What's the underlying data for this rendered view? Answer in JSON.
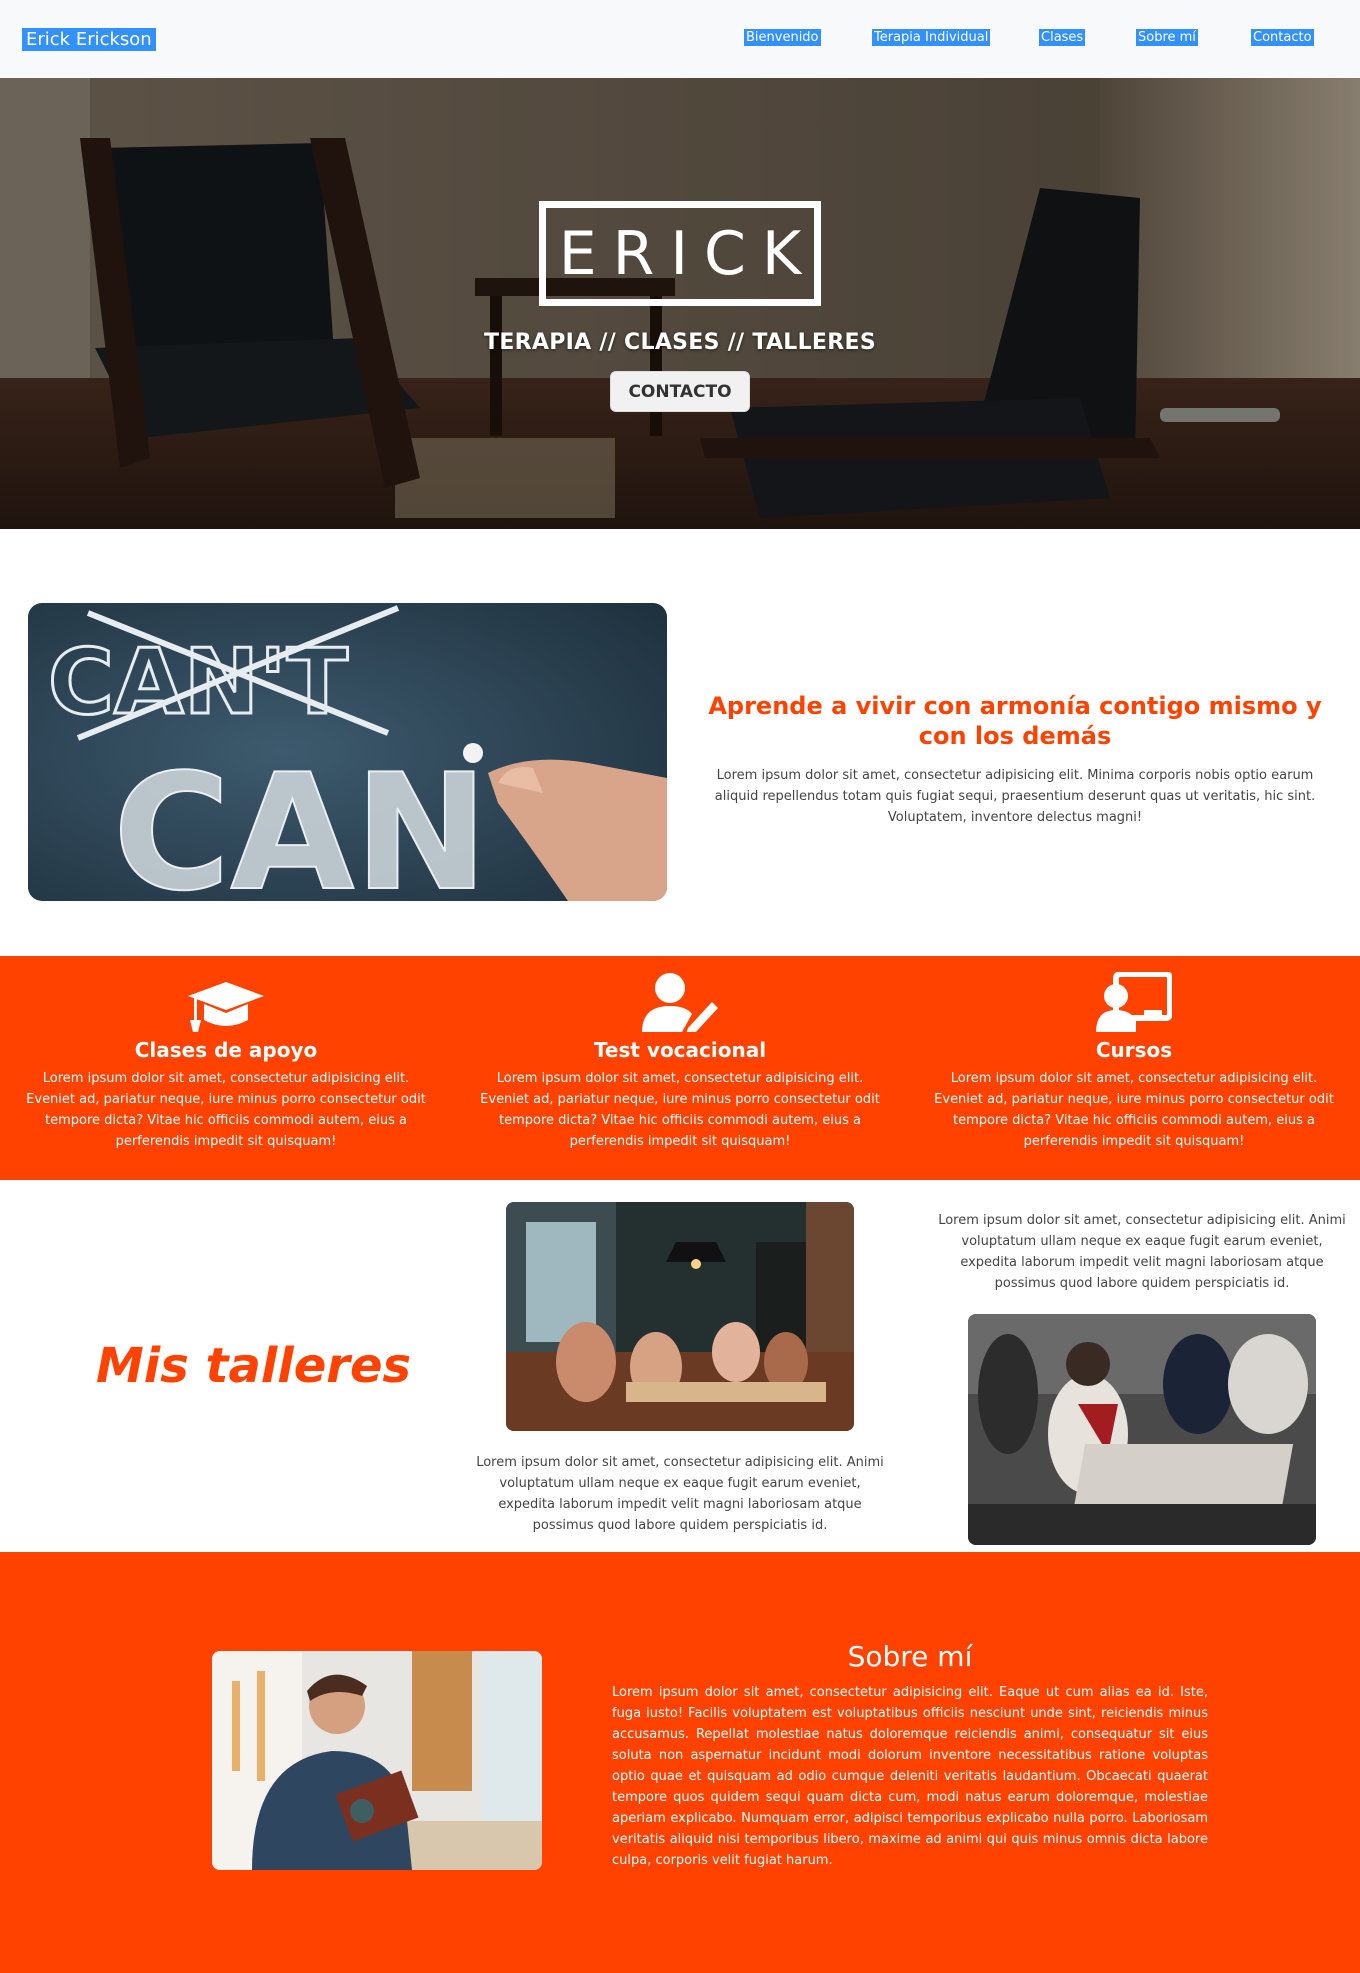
{
  "nav": {
    "brand": "Erick Erickson",
    "links": [
      "Bienvenido",
      "Terapia Individual",
      "Clases",
      "Sobre mí",
      "Contacto"
    ]
  },
  "hero": {
    "logo": "ERICK",
    "tagline": "TERAPIA // CLASES // TALLERES",
    "button": "CONTACTO"
  },
  "harmony": {
    "image_words": [
      "CAN'T",
      "CAN"
    ],
    "title": "Aprende a vivir con armonía contigo mismo y con los demás",
    "body": "Lorem ipsum dolor sit amet, consectetur adipisicing elit. Minima corporis nobis optio earum aliquid repellendus totam quis fugiat sequi, praesentium deserunt quas ut veritatis, hic sint. Voluptatem, inventore delectus magni!"
  },
  "services": [
    {
      "icon": "graduation-cap-icon",
      "title": "Clases de apoyo",
      "body": "Lorem ipsum dolor sit amet, consectetur adipisicing elit. Eveniet ad, pariatur neque, iure minus porro consectetur odit tempore dicta? Vitae hic officiis commodi autem, eius a perferendis impedit sit quisquam!"
    },
    {
      "icon": "user-pen-icon",
      "title": "Test vocacional",
      "body": "Lorem ipsum dolor sit amet, consectetur adipisicing elit. Eveniet ad, pariatur neque, iure minus porro consectetur odit tempore dicta? Vitae hic officiis commodi autem, eius a perferendis impedit sit quisquam!"
    },
    {
      "icon": "chalkboard-teacher-icon",
      "title": "Cursos",
      "body": "Lorem ipsum dolor sit amet, consectetur adipisicing elit. Eveniet ad, pariatur neque, iure minus porro consectetur odit tempore dicta? Vitae hic officiis commodi autem, eius a perferendis impedit sit quisquam!"
    }
  ],
  "workshops": {
    "title": "Mis talleres",
    "text1": "Lorem ipsum dolor sit amet, consectetur adipisicing elit. Animi voluptatum ullam neque ex eaque fugit earum eveniet, expedita laborum impedit velit magni laboriosam atque possimus quod labore quidem perspiciatis id.",
    "text2": "Lorem ipsum dolor sit amet, consectetur adipisicing elit. Animi voluptatum ullam neque ex eaque fugit earum eveniet, expedita laborum impedit velit magni laboriosam atque possimus quod labore quidem perspiciatis id."
  },
  "sobre": {
    "title": "Sobre mí",
    "body": "Lorem ipsum dolor sit amet, consectetur adipisicing elit. Eaque ut cum alias ea id. Iste, fuga iusto! Facilis voluptatem est voluptatibus officiis nesciunt unde sint, reiciendis minus accusamus. Repellat molestiae natus doloremque reiciendis animi, consequatur sit eius soluta non aspernatur incidunt modi dolorum inventore necessitatibus ratione voluptas optio quae et quisquam ad odio cumque deleniti veritatis laudantium. Obcaecati quaerat tempore quos quidem sequi quam dicta cum, modi natus earum doloremque, molestiae aperiam explicabo. Numquam error, adipisci temporibus explicabo nulla porro. Laboriosam veritatis aliquid nisi temporibus libero, maxime ad animi qui quis minus omnis dicta labore culpa, corporis velit fugiat harum."
  },
  "colors": {
    "accent": "#ff4200",
    "nav_highlight": "#3390ff",
    "nav_bg": "#f8f9fa"
  }
}
